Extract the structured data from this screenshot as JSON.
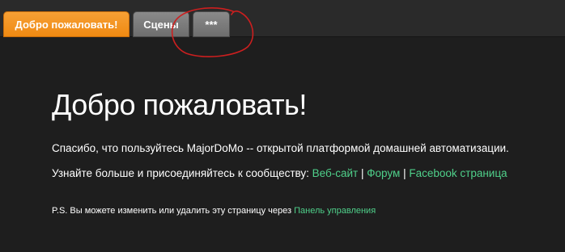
{
  "tabs": [
    {
      "label": "Добро пожаловать!",
      "active": true
    },
    {
      "label": "Сцены",
      "active": false
    },
    {
      "label": "***",
      "active": false
    }
  ],
  "colors": {
    "background": "#1e1e1e",
    "tab_active": "#f08a12",
    "tab_inactive": "#7a7a7a",
    "link": "#4fd08a",
    "annotation": "#cc1f1f"
  },
  "main": {
    "title": "Добро пожаловать!",
    "intro": "Спасибо, что пользуйтесь MajorDoMo -- открытой платформой домашней автоматизации.",
    "community_text": "Узнайте больше и присоединяйтесь к сообществу: ",
    "links": {
      "website": "Веб-сайт",
      "forum": "Форум",
      "facebook": "Facebook страница",
      "separator": "|"
    },
    "ps_text": "P.S. Вы можете изменить или удалить эту страницу через ",
    "ps_link": "Панель управления"
  }
}
